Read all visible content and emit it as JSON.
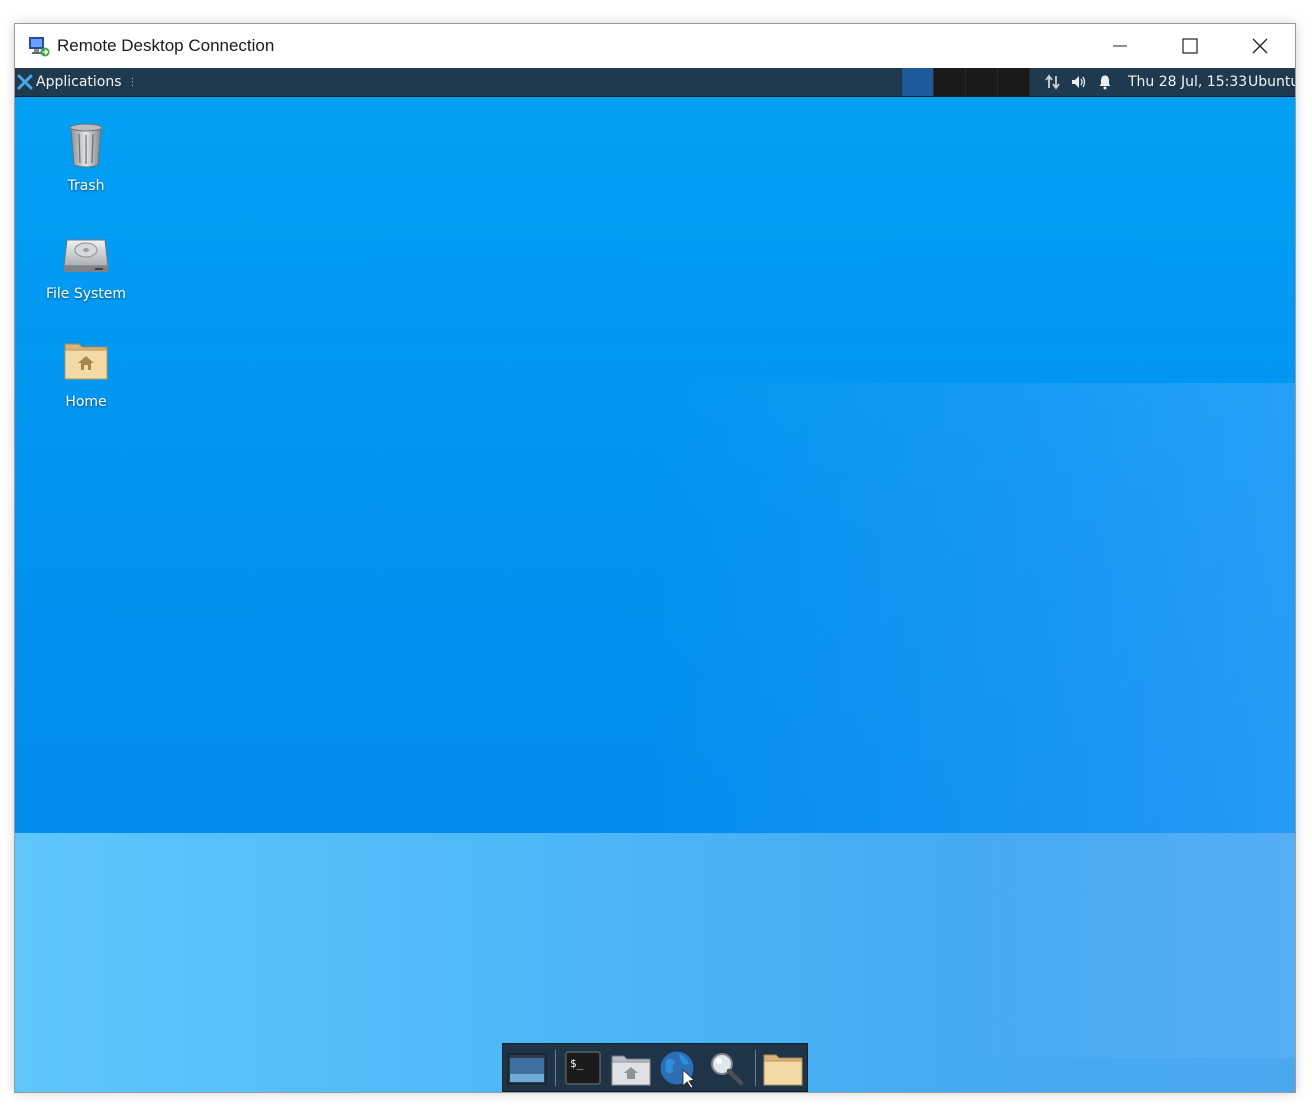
{
  "window": {
    "title": "Remote Desktop Connection",
    "icon": "remote-desktop-icon",
    "controls": [
      "minimize",
      "maximize",
      "close"
    ]
  },
  "panel": {
    "applications_label": "Applications",
    "workspaces": 4,
    "active_workspace": 1,
    "clock": "Thu 28 Jul, 15:33",
    "user": "Ubuntu",
    "tray_icons": [
      "network-icon",
      "volume-icon",
      "notification-bell-icon"
    ]
  },
  "desktop": {
    "icons": [
      {
        "label": "Trash",
        "icon": "trash-icon"
      },
      {
        "label": "File System",
        "icon": "hard-drive-icon"
      },
      {
        "label": "Home",
        "icon": "home-folder-icon"
      }
    ]
  },
  "dock": {
    "items": [
      "show-desktop-icon",
      "terminal-icon",
      "file-manager-icon",
      "web-browser-icon",
      "app-finder-icon",
      "folder-icon"
    ]
  },
  "colors": {
    "desktop_blue": "#0392f0",
    "panel": "#1f3a4e",
    "active_workspace": "#1d5a99"
  }
}
